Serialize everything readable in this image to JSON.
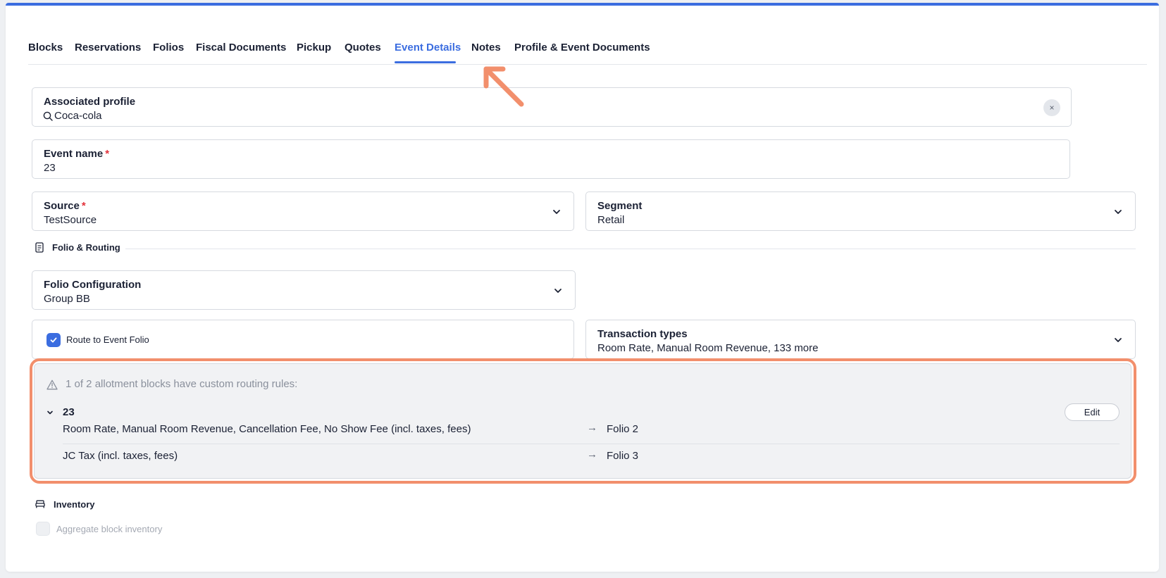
{
  "tabs": [
    {
      "label": "Blocks",
      "active": false
    },
    {
      "label": "Reservations",
      "active": false
    },
    {
      "label": "Folios",
      "active": false
    },
    {
      "label": "Fiscal Documents",
      "active": false
    },
    {
      "label": "Pickup",
      "active": false
    },
    {
      "label": "Quotes",
      "active": false
    },
    {
      "label": "Event Details",
      "active": true
    },
    {
      "label": "Notes",
      "active": false
    },
    {
      "label": "Profile & Event Documents",
      "active": false
    }
  ],
  "associated_profile": {
    "label": "Associated profile",
    "value": "Coca-cola",
    "clear_label": "×"
  },
  "event_name": {
    "label": "Event name",
    "required_mark": "*",
    "value": "23"
  },
  "source": {
    "label": "Source",
    "required_mark": "*",
    "value": "TestSource"
  },
  "segment": {
    "label": "Segment",
    "value": "Retail"
  },
  "folio_routing_section": {
    "title": "Folio & Routing"
  },
  "folio_configuration": {
    "label": "Folio Configuration",
    "value": "Group BB"
  },
  "route_to_event_folio": {
    "label": "Route to Event Folio",
    "checked": true
  },
  "transaction_types": {
    "label": "Transaction types",
    "value": "Room Rate, Manual Room Revenue, 133 more"
  },
  "routing_notice": {
    "warning": "1 of 2 allotment blocks have custom routing rules:",
    "block": {
      "name": "23",
      "edit_label": "Edit",
      "rules": [
        {
          "types": "Room Rate, Manual Room Revenue, Cancellation Fee, No Show Fee (incl. taxes, fees)",
          "arrow": "→",
          "target": "Folio 2"
        },
        {
          "types": "JC Tax (incl. taxes, fees)",
          "arrow": "→",
          "target": "Folio 3"
        }
      ]
    }
  },
  "inventory_section": {
    "title": "Inventory"
  },
  "aggregate_block_inventory": {
    "label": "Aggregate block inventory",
    "checked": false,
    "disabled": true
  },
  "colors": {
    "accent": "#3b6de0",
    "highlight": "#f28f6c",
    "required": "#e2323a"
  }
}
